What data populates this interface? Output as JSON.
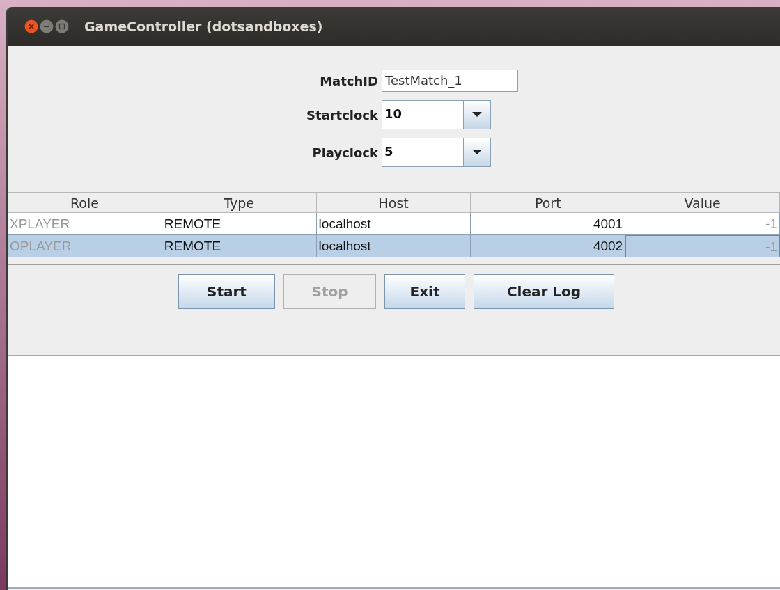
{
  "window": {
    "title": "GameController (dotsandboxes)"
  },
  "form": {
    "match_id": {
      "label": "MatchID",
      "value": "TestMatch_1"
    },
    "startclock": {
      "label": "Startclock",
      "value": "10"
    },
    "playclock": {
      "label": "Playclock",
      "value": "5"
    }
  },
  "table": {
    "columns": [
      "Role",
      "Type",
      "Host",
      "Port",
      "Value"
    ],
    "rows": [
      {
        "selected": false,
        "cells": [
          "XPLAYER",
          "REMOTE",
          "localhost",
          "4001",
          "-1"
        ]
      },
      {
        "selected": true,
        "cells": [
          "OPLAYER",
          "REMOTE",
          "localhost",
          "4002",
          "-1"
        ]
      }
    ]
  },
  "buttons": [
    {
      "label": "Start",
      "disabled": false
    },
    {
      "label": "Stop",
      "disabled": true
    },
    {
      "label": "Exit",
      "disabled": false
    },
    {
      "label": "Clear Log",
      "disabled": false
    }
  ]
}
